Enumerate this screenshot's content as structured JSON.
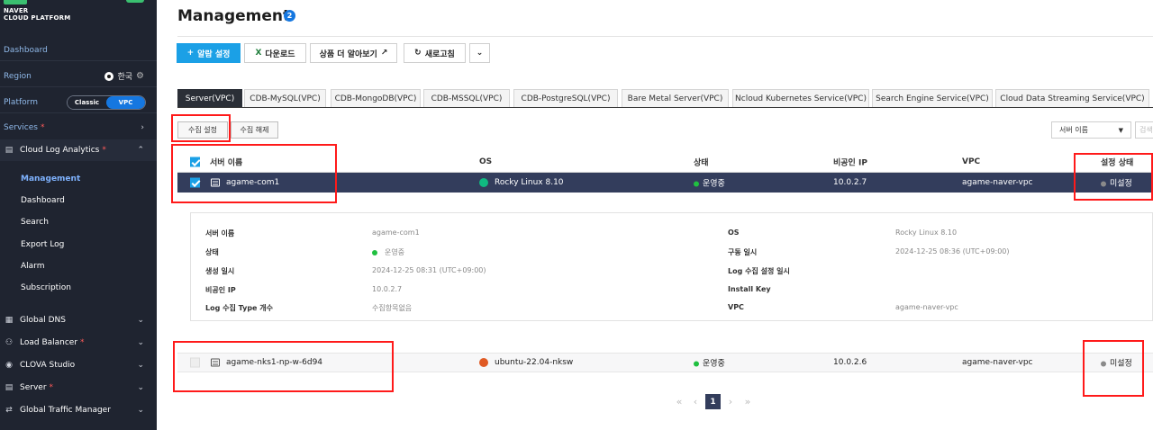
{
  "brand": {
    "line1": "NAVER",
    "line2": "CLOUD PLATFORM"
  },
  "sidebar": {
    "dashboard": "Dashboard",
    "region_label": "Region",
    "region_value": "한국",
    "platform_label": "Platform",
    "platform_options": [
      "Classic",
      "VPC"
    ],
    "platform_selected": "VPC",
    "services_label": "Services",
    "cloud_log": {
      "label": "Cloud Log Analytics",
      "items": [
        "Management",
        "Dashboard",
        "Search",
        "Export Log",
        "Alarm",
        "Subscription"
      ],
      "active": "Management"
    },
    "menus": [
      {
        "label": "Global DNS",
        "icon": "dns-icon",
        "new": false
      },
      {
        "label": "Load Balancer",
        "icon": "load-balancer-icon",
        "new": true
      },
      {
        "label": "CLOVA Studio",
        "icon": "clova-icon",
        "new": false
      },
      {
        "label": "Server",
        "icon": "server-icon",
        "new": true
      },
      {
        "label": "Global Traffic Manager",
        "icon": "traffic-icon",
        "new": false
      }
    ]
  },
  "page": {
    "title": "Management",
    "badge": "2"
  },
  "toolbar": {
    "alarm": "알람 설정",
    "download": "다운로드",
    "learn_more": "상품 더 알아보기",
    "refresh": "새로고침"
  },
  "tabs": [
    "Server(VPC)",
    "CDB-MySQL(VPC)",
    "CDB-MongoDB(VPC)",
    "CDB-MSSQL(VPC)",
    "CDB-PostgreSQL(VPC)",
    "Bare Metal Server(VPC)",
    "Ncloud Kubernetes Service(VPC)",
    "Search Engine Service(VPC)",
    "Cloud Data Streaming Service(VPC)"
  ],
  "actions": {
    "collect_set": "수집 설정",
    "collect_unset": "수집 해제"
  },
  "filter": {
    "selected": "서버 이름",
    "search_placeholder": "검색"
  },
  "table": {
    "headers": {
      "name": "서버 이름",
      "os": "OS",
      "status": "상태",
      "private_ip": "비공인 IP",
      "vpc": "VPC",
      "setting": "설정 상태"
    },
    "rows": [
      {
        "name": "agame-com1",
        "os": "Rocky Linux 8.10",
        "status": "운영중",
        "ip": "10.0.2.7",
        "vpc": "agame-naver-vpc",
        "setting": "미설정",
        "selected": true
      },
      {
        "name": "agame-nks1-np-w-6d94",
        "os": "ubuntu-22.04-nksw",
        "status": "운영중",
        "ip": "10.0.2.6",
        "vpc": "agame-naver-vpc",
        "setting": "미설정",
        "selected": false
      }
    ]
  },
  "detail": {
    "left": [
      {
        "label": "서버 이름",
        "value": "agame-com1"
      },
      {
        "label": "상태",
        "value": "운영중"
      },
      {
        "label": "생성 일시",
        "value": "2024-12-25 08:31 (UTC+09:00)"
      },
      {
        "label": "비공인 IP",
        "value": "10.0.2.7"
      },
      {
        "label": "Log 수집 Type 개수",
        "value": "수집항목없음"
      }
    ],
    "right": [
      {
        "label": "OS",
        "value": "Rocky Linux 8.10"
      },
      {
        "label": "구동 일시",
        "value": "2024-12-25 08:36 (UTC+09:00)"
      },
      {
        "label": "Log 수집 설정 일시",
        "value": ""
      },
      {
        "label": "Install Key",
        "value": ""
      },
      {
        "label": "VPC",
        "value": "agame-naver-vpc"
      }
    ]
  },
  "pagination": {
    "current": "1"
  }
}
